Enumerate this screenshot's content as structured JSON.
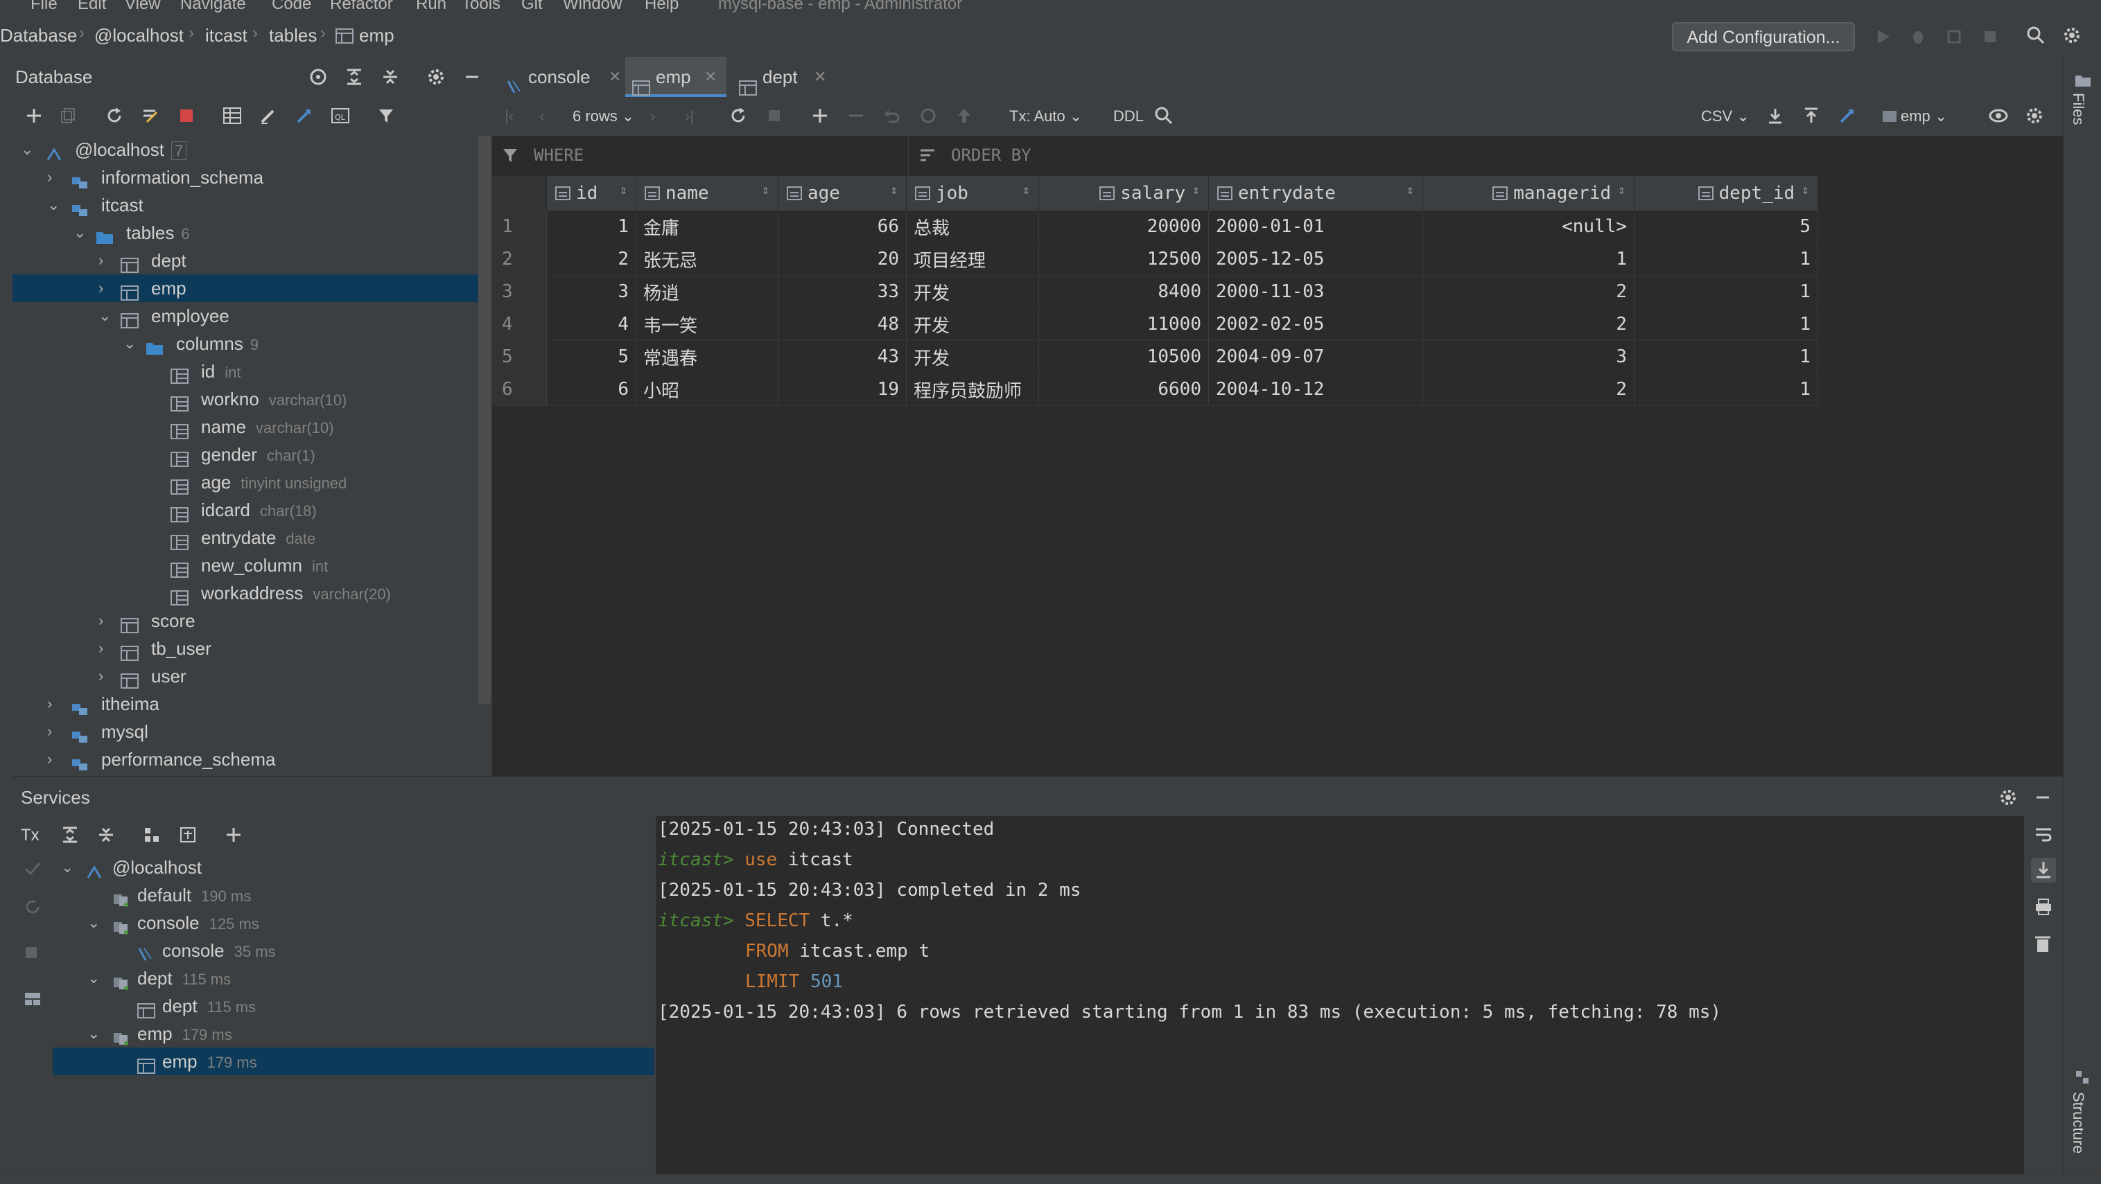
{
  "menu": [
    "File",
    "Edit",
    "View",
    "Navigate",
    "Code",
    "Refactor",
    "Run",
    "Tools",
    "Git",
    "Window",
    "Help"
  ],
  "window_title": "mysql-base - emp - Administrator",
  "breadcrumb": [
    "Database",
    "@localhost",
    "itcast",
    "tables",
    "emp"
  ],
  "run_config": "Add Configuration...",
  "db_panel": {
    "title": "Database",
    "tree": [
      {
        "label": "@localhost",
        "count": "7"
      },
      {
        "label": "information_schema"
      },
      {
        "label": "itcast"
      },
      {
        "label": "tables",
        "count": "6"
      },
      {
        "label": "dept"
      },
      {
        "label": "emp"
      },
      {
        "label": "employee"
      },
      {
        "label": "columns",
        "count": "9"
      },
      {
        "label": "id",
        "type": "int"
      },
      {
        "label": "workno",
        "type": "varchar(10)"
      },
      {
        "label": "name",
        "type": "varchar(10)"
      },
      {
        "label": "gender",
        "type": "char(1)"
      },
      {
        "label": "age",
        "type": "tinyint unsigned"
      },
      {
        "label": "idcard",
        "type": "char(18)"
      },
      {
        "label": "entrydate",
        "type": "date"
      },
      {
        "label": "new_column",
        "type": "int"
      },
      {
        "label": "workaddress",
        "type": "varchar(20)"
      },
      {
        "label": "score"
      },
      {
        "label": "tb_user"
      },
      {
        "label": "user"
      },
      {
        "label": "itheima"
      },
      {
        "label": "mysql"
      },
      {
        "label": "performance_schema"
      }
    ]
  },
  "tabs": [
    {
      "label": "console"
    },
    {
      "label": "emp"
    },
    {
      "label": "dept"
    }
  ],
  "grid_toolbar": {
    "rows": "6 rows",
    "tx": "Tx: Auto",
    "ddl": "DDL",
    "export_format": "CSV",
    "table_select": "emp"
  },
  "filter": {
    "where": "WHERE",
    "order_by": "ORDER BY"
  },
  "table": {
    "columns": [
      "id",
      "name",
      "age",
      "job",
      "salary",
      "entrydate",
      "managerid",
      "dept_id"
    ],
    "rows": [
      {
        "rn": "1",
        "cells": [
          "1",
          "金庸",
          "66",
          "总裁",
          "20000",
          "2000-01-01",
          "<null>",
          "5"
        ]
      },
      {
        "rn": "2",
        "cells": [
          "2",
          "张无忌",
          "20",
          "项目经理",
          "12500",
          "2005-12-05",
          "1",
          "1"
        ]
      },
      {
        "rn": "3",
        "cells": [
          "3",
          "杨逍",
          "33",
          "开发",
          "8400",
          "2000-11-03",
          "2",
          "1"
        ]
      },
      {
        "rn": "4",
        "cells": [
          "4",
          "韦一笑",
          "48",
          "开发",
          "11000",
          "2002-02-05",
          "2",
          "1"
        ]
      },
      {
        "rn": "5",
        "cells": [
          "5",
          "常遇春",
          "43",
          "开发",
          "10500",
          "2004-09-07",
          "3",
          "1"
        ]
      },
      {
        "rn": "6",
        "cells": [
          "6",
          "小昭",
          "19",
          "程序员鼓励师",
          "6600",
          "2004-10-12",
          "2",
          "1"
        ]
      }
    ]
  },
  "services": {
    "title": "Services",
    "tree": [
      {
        "label": "@localhost"
      },
      {
        "label": "default",
        "time": "190 ms"
      },
      {
        "label": "console",
        "time": "125 ms"
      },
      {
        "label": "console",
        "time": "35 ms"
      },
      {
        "label": "dept",
        "time": "115 ms"
      },
      {
        "label": "dept",
        "time": "115 ms"
      },
      {
        "label": "emp",
        "time": "179 ms"
      },
      {
        "label": "emp",
        "time": "179 ms"
      }
    ]
  },
  "console": {
    "line1": "[2025-01-15 20:43:03] Connected",
    "prompt": "itcast>",
    "l2_kw": "use",
    "l2_rest": " itcast",
    "line3": "[2025-01-15 20:43:03] completed in 2 ms",
    "l4_kw": "SELECT",
    "l4_rest": " t.*",
    "l5_kw": "FROM",
    "l5_rest": " itcast.emp t",
    "l6_kw": "LIMIT",
    "l6_num": "501",
    "line7": "[2025-01-15 20:43:03] 6 rows retrieved starting from 1 in 83 ms (execution: 5 ms, fetching: 78 ms)"
  },
  "side_tabs": {
    "files": "Files",
    "structure": "Structure"
  },
  "colors": {
    "selection": "#0d3a58",
    "accent": "#4a88c7",
    "keyword": "#cc7832",
    "prompt": "#4c8a36",
    "number": "#6897bb"
  }
}
